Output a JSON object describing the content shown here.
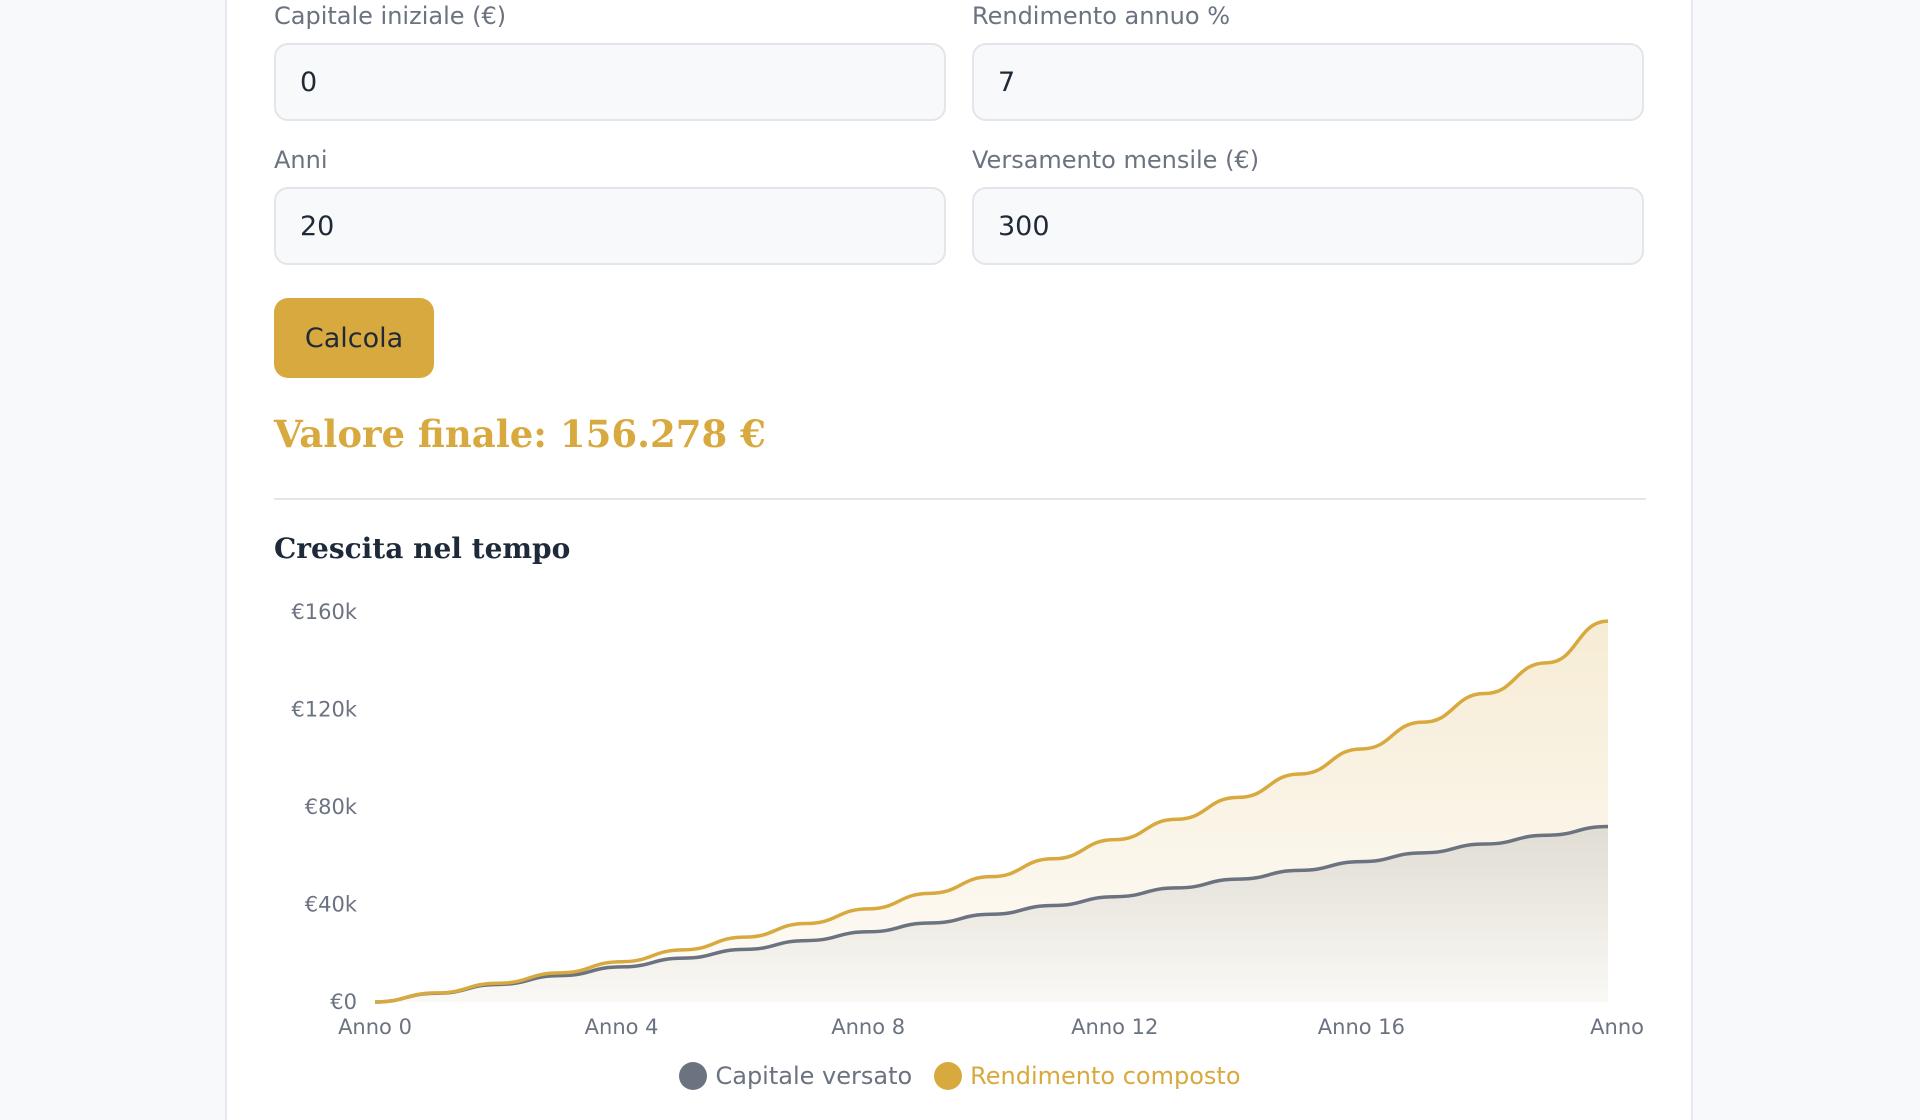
{
  "form": {
    "initial_capital_label": "Capitale iniziale (€)",
    "initial_capital_value": "0",
    "annual_return_label": "Rendimento annuo %",
    "annual_return_value": "7",
    "years_label": "Anni",
    "years_value": "20",
    "monthly_deposit_label": "Versamento mensile (€)",
    "monthly_deposit_value": "300",
    "calculate_label": "Calcola"
  },
  "result": {
    "text": "Valore finale: 156.278 €"
  },
  "chart_section": {
    "title": "Crescita nel tempo"
  },
  "colors": {
    "accent": "#d8a93e",
    "contributed": "#6b7280",
    "text_dark": "#1e2a3a"
  },
  "chart_data": {
    "type": "area",
    "x": [
      0,
      1,
      2,
      3,
      4,
      5,
      6,
      7,
      8,
      9,
      10,
      11,
      12,
      13,
      14,
      15,
      16,
      17,
      18,
      19,
      20
    ],
    "x_tick_labels": [
      "Anno 0",
      "Anno 4",
      "Anno 8",
      "Anno 12",
      "Anno 16",
      "Anno"
    ],
    "x_tick_values": [
      0,
      4,
      8,
      12,
      16,
      20
    ],
    "y_tick_labels": [
      "€0",
      "€40k",
      "€80k",
      "€120k",
      "€160k"
    ],
    "y_tick_values": [
      0,
      40000,
      80000,
      120000,
      160000
    ],
    "ylim": [
      0,
      160000
    ],
    "xlim": [
      0,
      20
    ],
    "series": [
      {
        "name": "Capitale versato",
        "color": "#6b7280",
        "values": [
          0,
          3600,
          7200,
          10800,
          14400,
          18000,
          21600,
          25200,
          28800,
          32400,
          36000,
          39600,
          43200,
          46800,
          50400,
          54000,
          57600,
          61200,
          64800,
          68400,
          72000
        ]
      },
      {
        "name": "Rendimento composto",
        "color": "#d8a93e",
        "values": [
          0,
          3722,
          7705,
          11967,
          16527,
          21407,
          26628,
          32215,
          38193,
          44589,
          51433,
          58756,
          66592,
          74976,
          83947,
          93546,
          103817,
          114807,
          126566,
          139148,
          156278
        ]
      }
    ]
  }
}
